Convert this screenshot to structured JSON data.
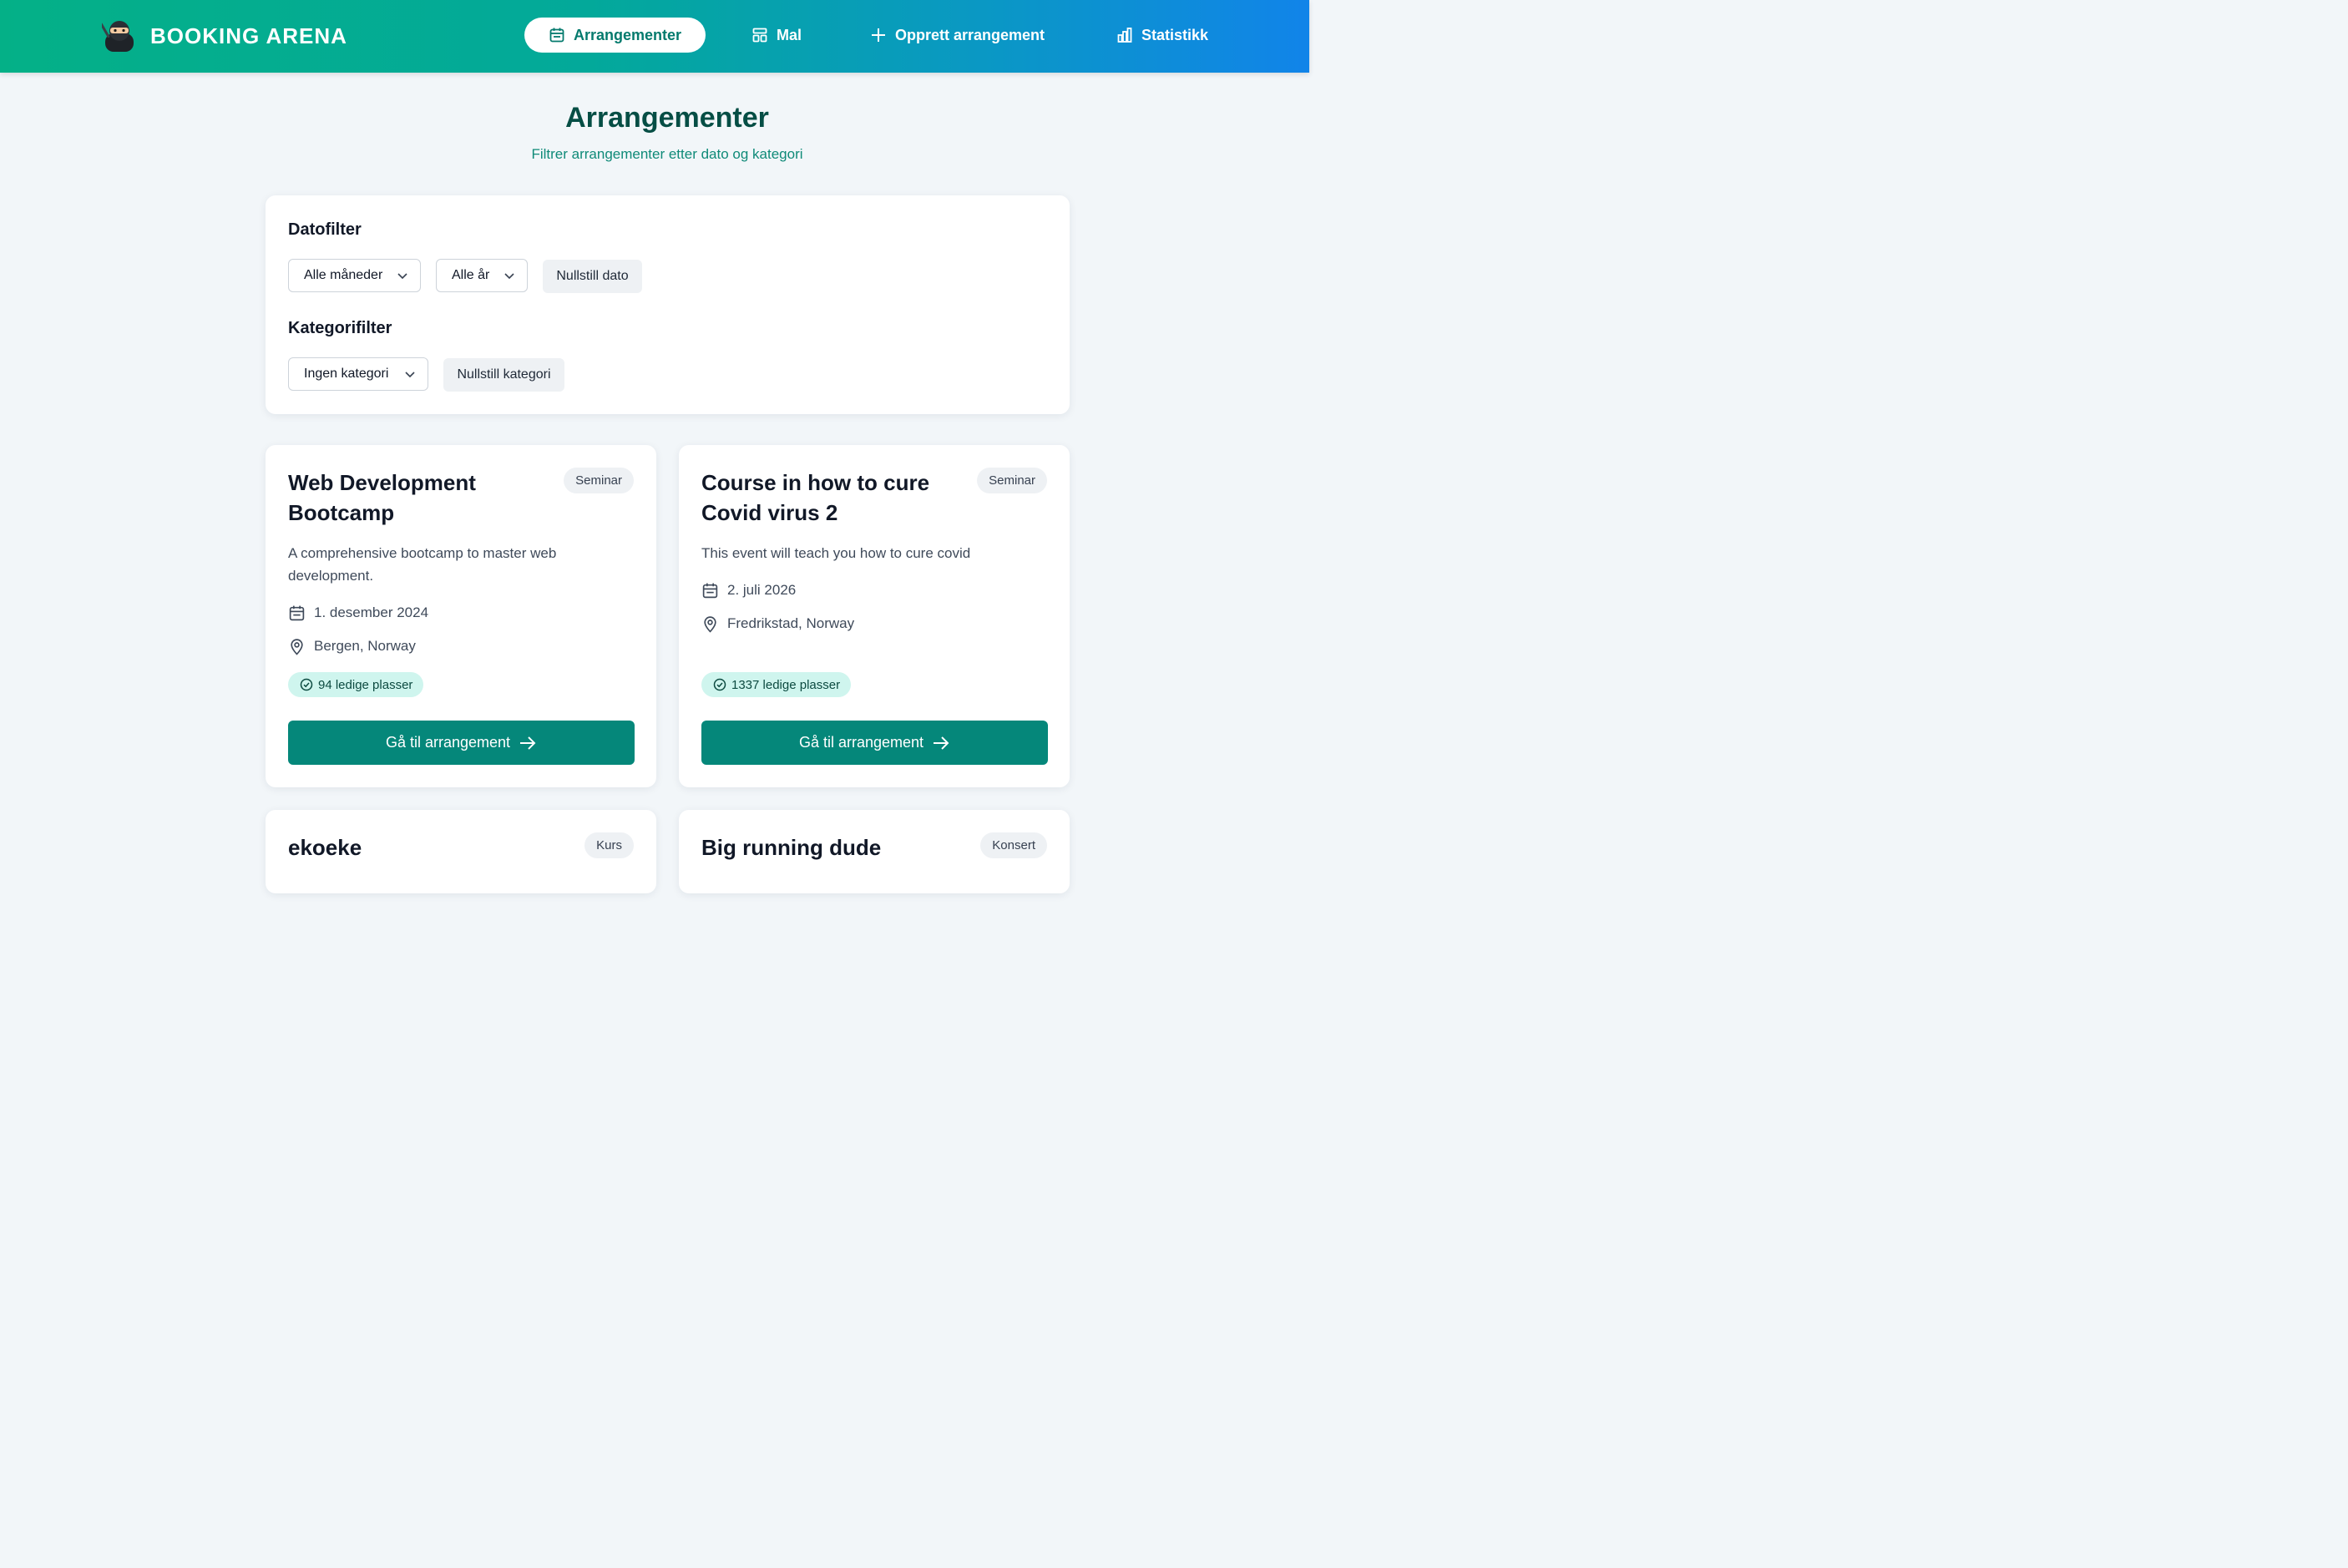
{
  "brand": {
    "name": "BOOKING ARENA",
    "logo": "ninja-logo"
  },
  "nav": {
    "events": "Arrangementer",
    "templates": "Mal",
    "create": "Opprett arrangement",
    "stats": "Statistikk"
  },
  "page": {
    "title": "Arrangementer",
    "subtitle": "Filtrer arrangementer etter dato og kategori"
  },
  "filters": {
    "date_label": "Datofilter",
    "month_select": "Alle måneder",
    "year_select": "Alle år",
    "reset_date": "Nullstill dato",
    "category_label": "Kategorifilter",
    "category_select": "Ingen kategori",
    "reset_category": "Nullstill kategori"
  },
  "events": [
    {
      "title": "Web Development Bootcamp",
      "category": "Seminar",
      "description": "A comprehensive bootcamp to master web development.",
      "date": "1. desember 2024",
      "location": "Bergen, Norway",
      "available": "94 ledige plasser",
      "button": "Gå til arrangement"
    },
    {
      "title": "Course in how to cure Covid virus 2",
      "category": "Seminar",
      "description": "This event will teach you how to cure covid",
      "date": "2. juli 2026",
      "location": "Fredrikstad, Norway",
      "available": "1337 ledige plasser",
      "button": "Gå til arrangement"
    },
    {
      "title": "ekoeke",
      "category": "Kurs"
    },
    {
      "title": "Big running dude",
      "category": "Konsert"
    }
  ],
  "colors": {
    "header_gradient_start": "#04b087",
    "header_gradient_end": "#1184e9",
    "primary": "#05877a",
    "available_badge": "#cff5ee",
    "page_background": "#f2f6f9"
  }
}
